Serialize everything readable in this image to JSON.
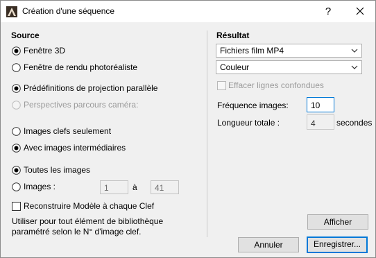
{
  "window": {
    "title": "Création d'une séquence",
    "help_label": "?",
    "icon": "archicad-app-icon"
  },
  "source": {
    "heading": "Source",
    "view_options": [
      {
        "label": "Fenêtre 3D",
        "selected": true,
        "enabled": true
      },
      {
        "label": "Fenêtre de rendu photoréaliste",
        "selected": false,
        "enabled": true
      }
    ],
    "projection_options": [
      {
        "label": "Prédéfinitions de projection parallèle",
        "selected": true,
        "enabled": true
      },
      {
        "label": "Perspectives parcours caméra:",
        "selected": false,
        "enabled": false
      }
    ],
    "frame_options": [
      {
        "label": "Images clefs seulement",
        "selected": false,
        "enabled": true
      },
      {
        "label": "Avec images intermédiaires",
        "selected": true,
        "enabled": true
      }
    ],
    "range_options": [
      {
        "label": "Toutes les images",
        "selected": true,
        "enabled": true
      },
      {
        "label": "Images :",
        "selected": false,
        "enabled": true
      }
    ],
    "range_from": "1",
    "range_to_label": "à",
    "range_to": "41",
    "rebuild_checkbox": {
      "label": "Reconstruire Modèle à chaque Clef",
      "checked": false
    },
    "note_line1": "Utiliser pour tout élément de bibliothèque",
    "note_line2": "paramétré selon le N° d'image clef."
  },
  "result": {
    "heading": "Résultat",
    "format_select": "Fichiers film MP4",
    "color_select": "Couleur",
    "erase_lines_checkbox": {
      "label": "Effacer lignes confondues",
      "checked": false,
      "enabled": false
    },
    "frame_rate_label": "Fréquence images:",
    "frame_rate_value": "10",
    "total_length_label": "Longueur totale :",
    "total_length_value": "4",
    "total_length_unit": "secondes"
  },
  "buttons": {
    "show": "Afficher",
    "cancel": "Annuler",
    "save": "Enregistrer..."
  }
}
